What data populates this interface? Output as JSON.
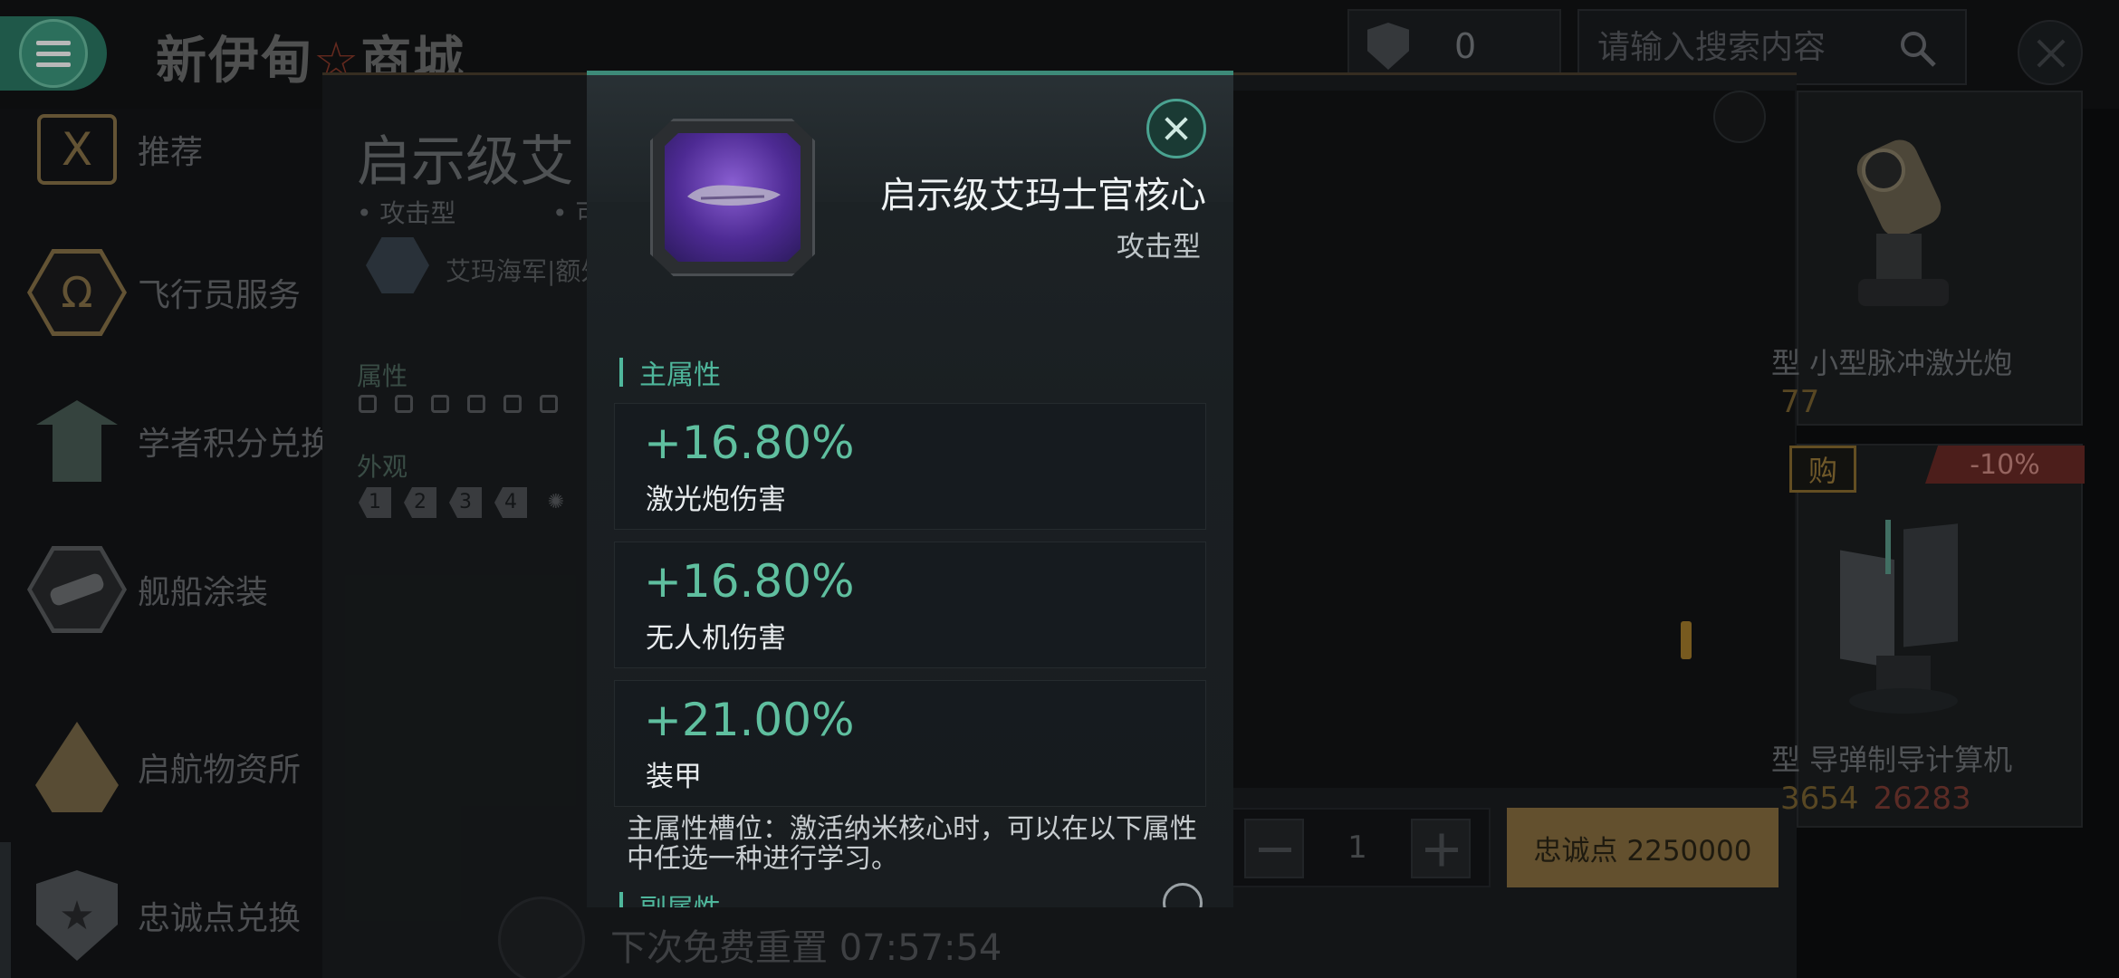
{
  "store": {
    "title_part1": "新伊甸",
    "title_star": "☆",
    "title_part2": "商城"
  },
  "currency": {
    "value": "0",
    "icon": "shield-star-icon"
  },
  "search": {
    "placeholder": "请输入搜索内容"
  },
  "sidebar": {
    "items": [
      {
        "label": "推荐",
        "icon": "recommend-icon"
      },
      {
        "label": "飞行员服务",
        "icon": "omega-icon",
        "glyph": "Ω"
      },
      {
        "label": "学者积分兑换",
        "icon": "scholar-icon"
      },
      {
        "label": "舰船涂装",
        "icon": "ship-paint-icon"
      },
      {
        "label": "启航物资所",
        "icon": "supply-icon"
      },
      {
        "label": "忠诚点兑换",
        "icon": "loyalty-icon"
      }
    ]
  },
  "background_item": {
    "title": "启示级艾",
    "sub1": "• 攻击型",
    "sub2": "• 可",
    "corp": "艾玛海军|额外",
    "attr_label": "属性",
    "look_label": "外观",
    "skins": [
      "1",
      "2",
      "3",
      "4"
    ]
  },
  "cards": [
    {
      "name": "型 小型脉冲激光炮",
      "price": "77"
    },
    {
      "name": "型 导弹制导计算机",
      "price": "3654",
      "orig_price": "26283",
      "buy_tag": "购",
      "discount": "-10%"
    }
  ],
  "purchase": {
    "qty": "1",
    "button": "忠诚点 2250000"
  },
  "reset": {
    "text": "下次免费重置 07:57:54"
  },
  "modal": {
    "name": "启示级艾玛士官核心",
    "type": "攻击型",
    "main_attr_title": "主属性",
    "stats": [
      {
        "value": "+16.80%",
        "name": "激光炮伤害"
      },
      {
        "value": "+16.80%",
        "name": "无人机伤害"
      },
      {
        "value": "+21.00%",
        "name": "装甲"
      }
    ],
    "slot_note": "主属性槽位：激活纳米核心时，可以在以下属性中任选一种进行学习。",
    "sub_attr_title": "副属性",
    "accent_color": "#4fb79c",
    "rarity_color": "#6b3fc0"
  }
}
